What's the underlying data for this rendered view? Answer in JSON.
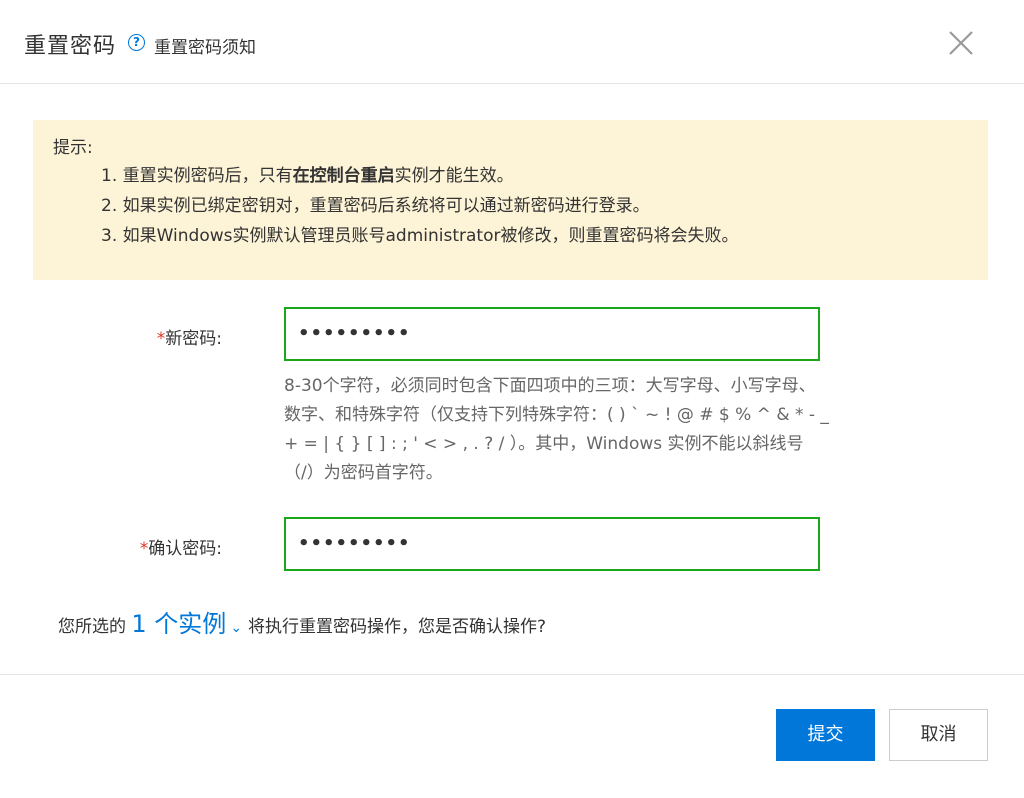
{
  "dialog": {
    "title": "重置密码",
    "help_link": "重置密码须知"
  },
  "notice": {
    "title": "提示:",
    "line1_prefix": "1. 重置实例密码后，只有",
    "line1_bold": "在控制台重启",
    "line1_suffix": "实例才能生效。",
    "line2": "2. 如果实例已绑定密钥对，重置密码后系统将可以通过新密码进行登录。",
    "line3": "3. 如果Windows实例默认管理员账号administrator被修改，则重置密码将会失败。"
  },
  "form": {
    "required_mark": "*",
    "new_password_label": "新密码:",
    "new_password_value": "•••••••••",
    "confirm_password_label": "确认密码:",
    "confirm_password_value": "•••••••••",
    "hint": "8-30个字符，必须同时包含下面四项中的三项：大写字母、小写字母、数字、和特殊字符（仅支持下列特殊字符：( ) ` ~ ! @ # $ % ^ & * - _ + = | { } [ ] : ; ' < > , . ? / ）。其中，Windows 实例不能以斜线号（/）为密码首字符。"
  },
  "confirm": {
    "prefix": "您所选的",
    "instances_link": "1 个实例",
    "caret": "⌄",
    "suffix": "将执行重置密码操作，您是否确认操作?"
  },
  "buttons": {
    "submit": "提交",
    "cancel": "取消"
  },
  "colors": {
    "primary": "#0077d9",
    "notice_bg": "#fdf3d6",
    "input_border_valid": "#1aa81a",
    "required": "#e0372a"
  },
  "icons": {
    "help": "question-circle-icon",
    "close": "close-icon",
    "caret": "chevron-down-icon"
  }
}
